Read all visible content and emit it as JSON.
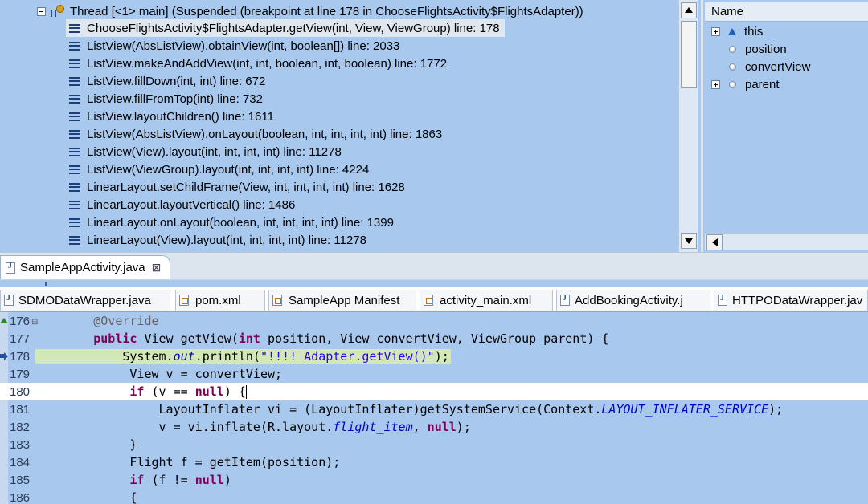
{
  "debug": {
    "thread_label": "Thread [<1> main] (Suspended (breakpoint at line 178 in ChooseFlightsActivity$FlightsAdapter))",
    "frames": [
      "ChooseFlightsActivity$FlightsAdapter.getView(int, View, ViewGroup) line: 178",
      "ListView(AbsListView).obtainView(int, boolean[]) line: 2033",
      "ListView.makeAndAddView(int, int, boolean, int, boolean) line: 1772",
      "ListView.fillDown(int, int) line: 672",
      "ListView.fillFromTop(int) line: 732",
      "ListView.layoutChildren() line: 1611",
      "ListView(AbsListView).onLayout(boolean, int, int, int, int) line: 1863",
      "ListView(View).layout(int, int, int, int) line: 11278",
      "ListView(ViewGroup).layout(int, int, int, int) line: 4224",
      "LinearLayout.setChildFrame(View, int, int, int, int) line: 1628",
      "LinearLayout.layoutVertical() line: 1486",
      "LinearLayout.onLayout(boolean, int, int, int, int) line: 1399",
      "LinearLayout(View).layout(int, int, int, int) line: 11278"
    ]
  },
  "variables": {
    "column_name": "Name",
    "items": [
      {
        "name": "this",
        "expandable": true,
        "icon": "triangle-icon"
      },
      {
        "name": "position",
        "expandable": false,
        "icon": "local-variable-icon"
      },
      {
        "name": "convertView",
        "expandable": false,
        "icon": "local-variable-icon"
      },
      {
        "name": "parent",
        "expandable": true,
        "icon": "local-variable-icon"
      }
    ]
  },
  "editor": {
    "active_tab": "SampleAppActivity.java",
    "file_tabs": [
      "SDMODataWrapper.java",
      "pom.xml",
      "SampleApp Manifest",
      "activity_main.xml",
      "AddBookingActivity.j",
      "HTTPODataWrapper.jav"
    ],
    "line_numbers": [
      "176",
      "177",
      "178",
      "179",
      "180",
      "181",
      "182",
      "183",
      "184",
      "185",
      "186"
    ]
  },
  "colors": {
    "debug_background": "#a8c8ee",
    "selected_frame": "#dfe6ee",
    "debug_line_highlight": "#d2e8b8",
    "keyword": "#7f0055",
    "string": "#2a00ff",
    "annotation": "#646464",
    "static_field": "#0000c0"
  }
}
